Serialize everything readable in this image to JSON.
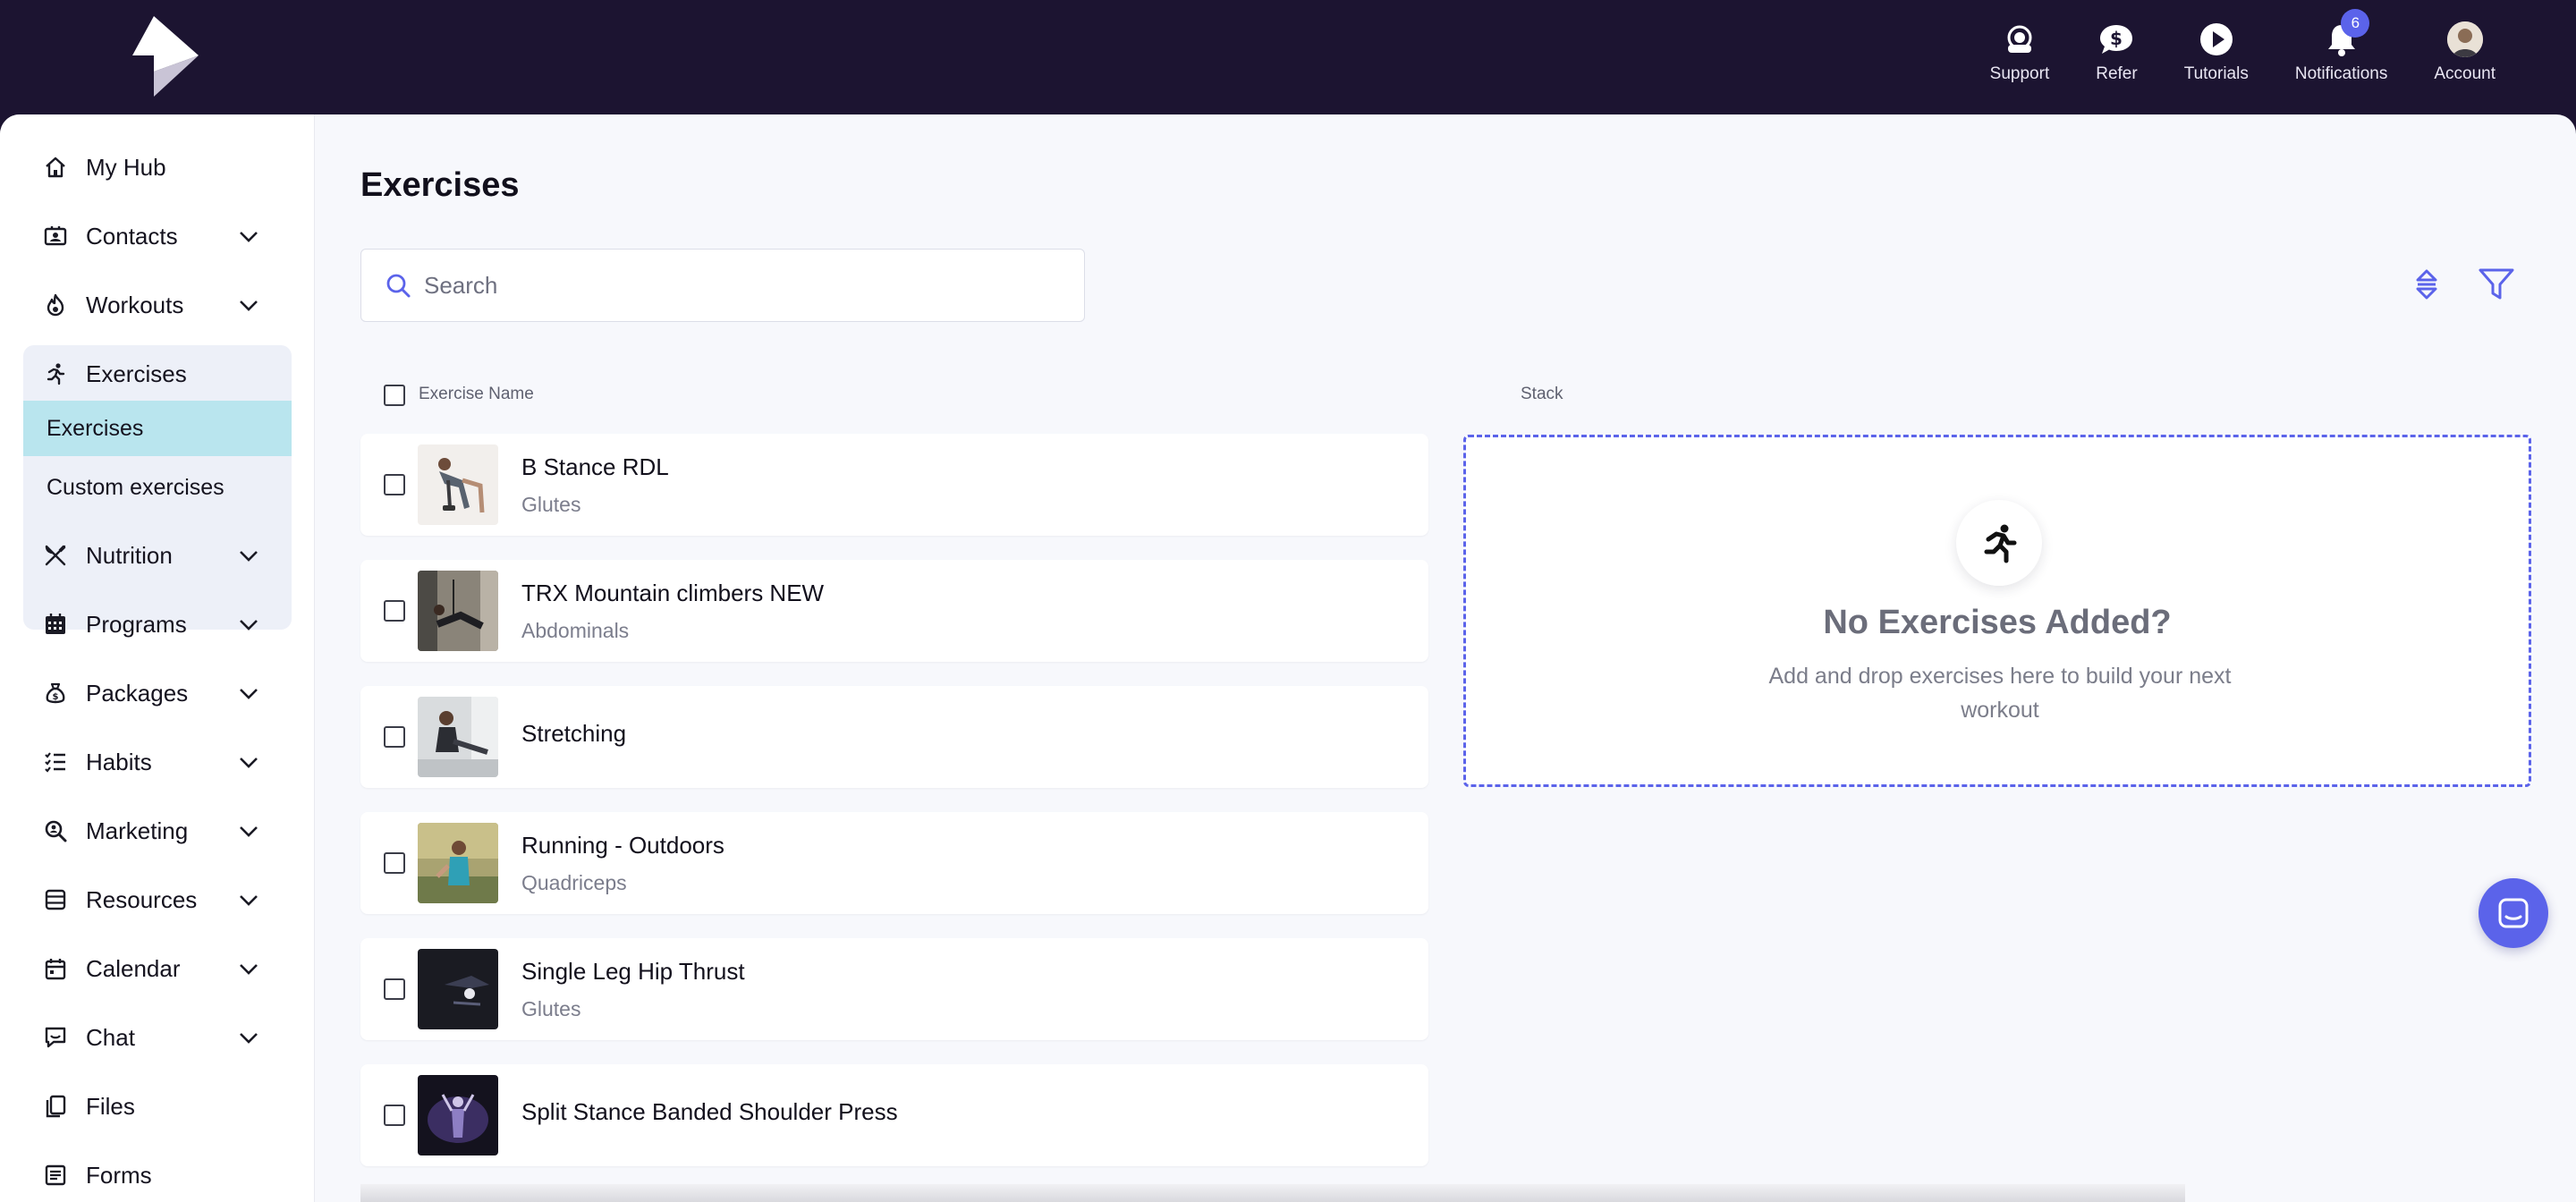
{
  "topbar": {
    "actions": [
      {
        "label": "Support",
        "icon": "headset-icon"
      },
      {
        "label": "Refer",
        "icon": "dollar-chat-icon"
      },
      {
        "label": "Tutorials",
        "icon": "play-circle-icon"
      },
      {
        "label": "Notifications",
        "icon": "bell-icon",
        "badge": "6"
      },
      {
        "label": "Account",
        "icon": "avatar"
      }
    ]
  },
  "sidebar": {
    "items": [
      {
        "label": "My Hub",
        "icon": "home-icon"
      },
      {
        "label": "Contacts",
        "icon": "contact-card-icon"
      },
      {
        "label": "Workouts",
        "icon": "flame-icon"
      },
      {
        "label": "Exercises",
        "icon": "running-person-icon"
      },
      {
        "label": "Nutrition",
        "icon": "fork-knife-icon"
      },
      {
        "label": "Programs",
        "icon": "calendar-grid-icon"
      },
      {
        "label": "Packages",
        "icon": "money-bag-icon"
      },
      {
        "label": "Habits",
        "icon": "checklist-icon"
      },
      {
        "label": "Marketing",
        "icon": "magnifier-icon"
      },
      {
        "label": "Resources",
        "icon": "database-icon"
      },
      {
        "label": "Calendar",
        "icon": "calendar-icon"
      },
      {
        "label": "Chat",
        "icon": "chat-icon"
      },
      {
        "label": "Files",
        "icon": "files-icon"
      },
      {
        "label": "Forms",
        "icon": "form-icon"
      }
    ],
    "sub_items": [
      {
        "label": "Exercises",
        "active": true
      },
      {
        "label": "Custom exercises",
        "active": false
      }
    ]
  },
  "main": {
    "title": "Exercises",
    "search_placeholder": "Search",
    "col_name": "Exercise Name",
    "col_stack": "Stack",
    "exercises": [
      {
        "name": "B Stance RDL",
        "muscle": "Glutes"
      },
      {
        "name": "TRX Mountain climbers NEW",
        "muscle": "Abdominals"
      },
      {
        "name": "Stretching",
        "muscle": ""
      },
      {
        "name": "Running - Outdoors",
        "muscle": "Quadriceps"
      },
      {
        "name": "Single Leg Hip Thrust",
        "muscle": "Glutes"
      },
      {
        "name": "Split Stance Banded Shoulder Press",
        "muscle": ""
      }
    ],
    "stack": {
      "title": "No Exercises Added?",
      "subtitle": "Add and drop exercises here to build your next workout"
    }
  },
  "colors": {
    "topbar": "#1c1431",
    "accent": "#5b63ea",
    "active_sub": "#b9e5ee",
    "background": "#f7f8fc"
  }
}
